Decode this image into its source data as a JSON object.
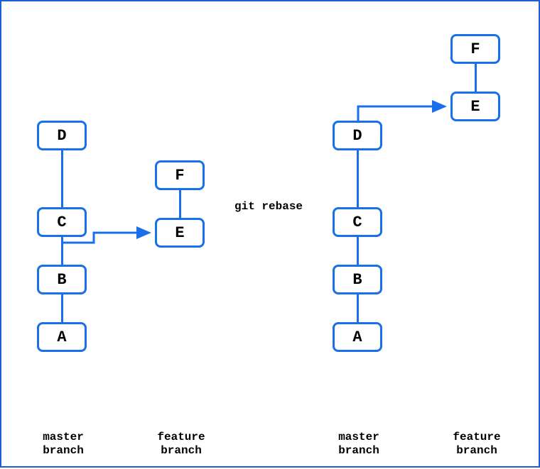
{
  "chart_data": {
    "type": "diagram",
    "title": "git rebase",
    "before": {
      "master": {
        "branch_label": "master\nbranch",
        "commits": [
          "A",
          "B",
          "C",
          "D"
        ]
      },
      "feature": {
        "branch_label": "feature\nbranch",
        "branches_from": "B",
        "commits": [
          "E",
          "F"
        ]
      }
    },
    "after": {
      "master": {
        "branch_label": "master\nbranch",
        "commits": [
          "A",
          "B",
          "C",
          "D"
        ]
      },
      "feature": {
        "branch_label": "feature\nbranch",
        "branches_from": "D",
        "commits": [
          "E",
          "F"
        ]
      }
    },
    "operation_label": "git rebase"
  },
  "left": {
    "master": {
      "A": "A",
      "B": "B",
      "C": "C",
      "D": "D"
    },
    "feature": {
      "E": "E",
      "F": "F"
    },
    "master_label": "master\nbranch",
    "feature_label": "feature\nbranch"
  },
  "right": {
    "master": {
      "A": "A",
      "B": "B",
      "C": "C",
      "D": "D"
    },
    "feature": {
      "E": "E",
      "F": "F"
    },
    "master_label": "master\nbranch",
    "feature_label": "feature\nbranch"
  },
  "rebase_label": "git rebase",
  "colors": {
    "box_border": "#1a6fea",
    "arrow_red": "#ef4a3e",
    "frame": "#1a5fd6"
  }
}
